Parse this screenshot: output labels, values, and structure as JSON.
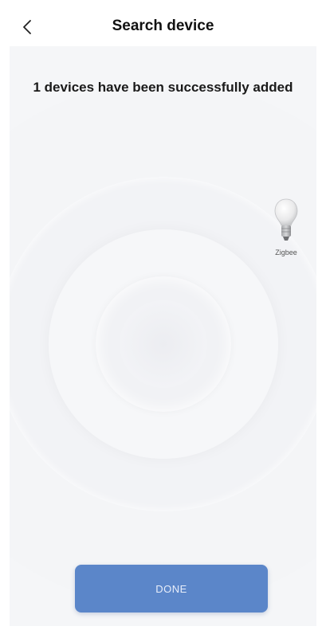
{
  "header": {
    "back_icon": "chevron-left-icon",
    "title": "Search device"
  },
  "status": {
    "message": "1 devices have been successfully added"
  },
  "devices": [
    {
      "icon": "light-bulb-icon",
      "label": "Zigbee"
    }
  ],
  "footer": {
    "done_label": "DONE"
  },
  "colors": {
    "background": "#f5f6f8",
    "accent": "#5b86c9",
    "title_text": "#111111"
  }
}
